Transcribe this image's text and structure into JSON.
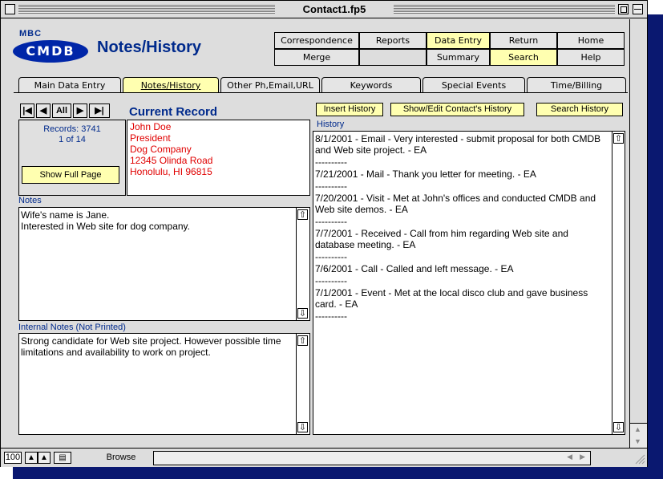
{
  "window": {
    "title": "Contact1.fp5"
  },
  "logo": {
    "top": "MBC",
    "main": "CMDB"
  },
  "page_title": "Notes/History",
  "nav": {
    "row1": [
      "Correspondence",
      "Reports",
      "Data Entry",
      "Return",
      "Home"
    ],
    "row2": [
      "Merge",
      "",
      "Summary",
      "Search",
      "Help"
    ]
  },
  "tabs": [
    "Main Data Entry",
    "Notes/History",
    "Other Ph,Email,URL",
    "Keywords",
    "Special Events",
    "Time/Billing"
  ],
  "active_tab": "Notes/History",
  "record_nav": {
    "first": "|◀",
    "prev": "◀",
    "all": "All",
    "next": "▶",
    "last": "▶|"
  },
  "current_record_label": "Current Record",
  "records": {
    "total_label": "Records: 3741",
    "position_label": "1 of 14"
  },
  "show_full_page": "Show Full Page",
  "contact": {
    "name": "John Doe",
    "title": "President",
    "company": "Dog Company",
    "address": "12345 Olinda Road",
    "city_state_zip": "Honolulu, HI  96815"
  },
  "notes": {
    "label": "Notes",
    "lines": [
      "Wife's name is Jane.",
      "Interested in Web site for dog company."
    ]
  },
  "internal_notes": {
    "label": "Internal Notes (Not Printed)",
    "text": "Strong candidate for Web site project. However possible time limitations and availability to work on project."
  },
  "history_buttons": [
    "Insert History",
    "Show/Edit Contact's History",
    "Search History"
  ],
  "history": {
    "label": "History",
    "entries": [
      "8/1/2001 - Email - Very interested - submit proposal for both CMDB and Web site project. - EA",
      "7/21/2001 - Mail - Thank you letter for meeting. - EA",
      "7/20/2001 - Visit - Met at John's offices and conducted CMDB and Web site demos. - EA",
      "7/7/2001 - Received - Call from him regarding Web site and database meeting. - EA",
      "7/6/2001 - Call - Called and left message. - EA",
      "7/1/2001 - Event - Met at the local disco club and gave business card. - EA"
    ],
    "separator": "----------"
  },
  "status": {
    "zoom": "100",
    "mode": "Browse"
  },
  "colors": {
    "accent_blue": "#002a8c",
    "button_yellow": "#ffffb0",
    "contact_red": "#e00000",
    "shadow": "#0a1870"
  }
}
